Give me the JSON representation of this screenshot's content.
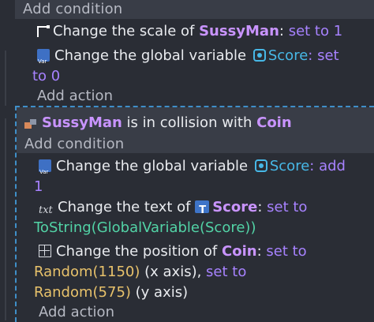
{
  "event1": {
    "add_condition": "Add condition",
    "actions": [
      {
        "icon": "scale-icon",
        "text1": "Change the scale of ",
        "obj": "SussyMan",
        "text2": ":",
        "kw": " set to ",
        "val": "1"
      },
      {
        "icon": "variable-icon",
        "text1": "Change the global variable ",
        "var": "Score",
        "text2": ": set",
        "line2": "to 0"
      }
    ],
    "add_action": "Add action"
  },
  "event2": {
    "condition": {
      "icon": "collision-icon",
      "obj1": "SussyMan",
      "text": " is in collision with ",
      "obj2": "Coin"
    },
    "add_condition": "Add condition",
    "actions": [
      {
        "icon": "variable-icon",
        "text1": "Change the global variable ",
        "var": "Score",
        "text2": ": add",
        "line2": "1"
      },
      {
        "icon": "text-icon",
        "icon_label": "txt",
        "text1": "Change the text of ",
        "obj": "Score",
        "text2": ":",
        "kw": " set to",
        "line2": "ToString(GlobalVariable(Score))"
      },
      {
        "icon": "position-icon",
        "text1": "Change the position of ",
        "obj": "Coin",
        "text2": ":",
        "kw": " set to",
        "line2_expr": "Random(1150)",
        "line2_text": " (x axis), ",
        "line2_kw": "set to",
        "line3_expr": "Random(575)",
        "line3_text": " (y axis)"
      }
    ],
    "add_action": "Add action"
  }
}
